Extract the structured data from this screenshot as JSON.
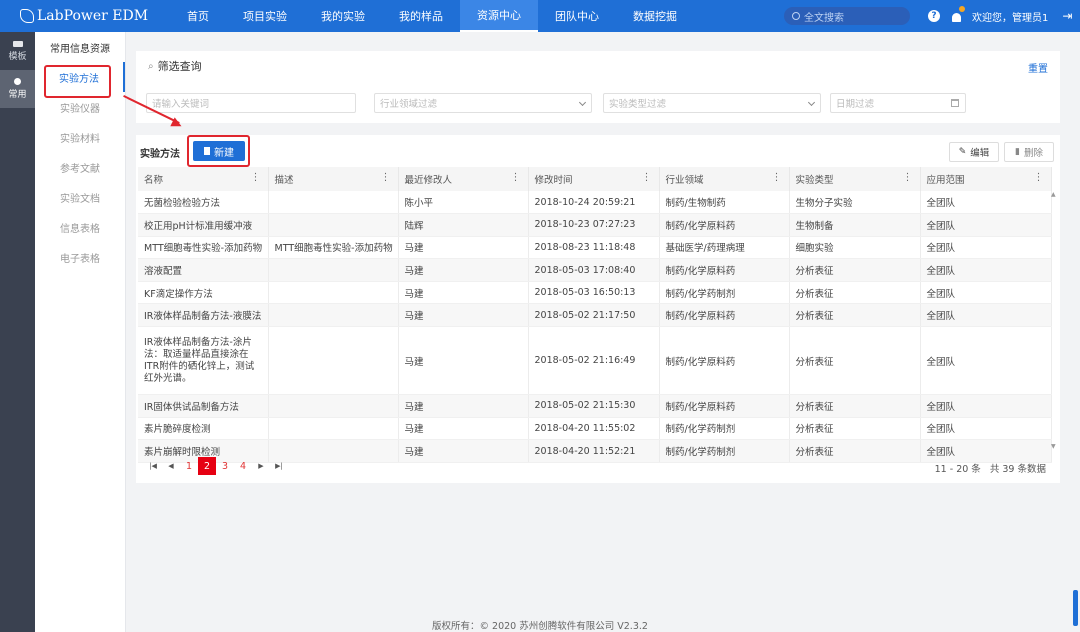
{
  "app": {
    "logo_text": "LabPower EDM"
  },
  "nav": [
    {
      "label": "首页"
    },
    {
      "label": "项目实验"
    },
    {
      "label": "我的实验"
    },
    {
      "label": "我的样品"
    },
    {
      "label": "资源中心",
      "active": true
    },
    {
      "label": "团队中心"
    },
    {
      "label": "数据挖掘"
    }
  ],
  "search": {
    "placeholder": "全文搜索"
  },
  "user": {
    "greeting": "欢迎您，管理员1"
  },
  "iconbar": [
    {
      "label": "模板"
    },
    {
      "label": "常用",
      "active": true
    }
  ],
  "submenu": {
    "title": "常用信息资源",
    "items": [
      {
        "label": "实验方法",
        "active": true
      },
      {
        "label": "实验仪器"
      },
      {
        "label": "实验材料"
      },
      {
        "label": "参考文献"
      },
      {
        "label": "实验文档"
      },
      {
        "label": "信息表格"
      },
      {
        "label": "电子表格"
      }
    ]
  },
  "filter": {
    "title": "筛选查询",
    "reset": "重置",
    "keyword_placeholder": "请输入关键词",
    "industry_placeholder": "行业领域过滤",
    "type_placeholder": "实验类型过滤",
    "date_placeholder": "日期过滤"
  },
  "panel": {
    "title": "实验方法",
    "new_label": "新建",
    "edit_label": "编辑",
    "delete_label": "删除"
  },
  "table": {
    "columns": [
      "名称",
      "描述",
      "最近修改人",
      "修改时间",
      "行业领域",
      "实验类型",
      "应用范围"
    ],
    "rows": [
      [
        "无菌检验检验方法",
        "",
        "陈小平",
        "2018-10-24 20:59:21",
        "制药/生物制药",
        "生物分子实验",
        "全团队"
      ],
      [
        "校正用pH计标准用缓冲液",
        "",
        "陆辉",
        "2018-10-23 07:27:23",
        "制药/化学原料药",
        "生物制备",
        "全团队"
      ],
      [
        "MTT细胞毒性实验-添加药物",
        "MTT细胞毒性实验-添加药物",
        "马建",
        "2018-08-23 11:18:48",
        "基础医学/药理病理",
        "细胞实验",
        "全团队"
      ],
      [
        "溶液配置",
        "",
        "马建",
        "2018-05-03 17:08:40",
        "制药/化学原料药",
        "分析表征",
        "全团队"
      ],
      [
        "KF滴定操作方法",
        "",
        "马建",
        "2018-05-03 16:50:13",
        "制药/化学药制剂",
        "分析表征",
        "全团队"
      ],
      [
        "IR液体样品制备方法-液膜法",
        "",
        "马建",
        "2018-05-02 21:17:50",
        "制药/化学原料药",
        "分析表征",
        "全团队"
      ],
      [
        "IR液体样品制备方法-涂片法：取适量样品直接涂在ITR附件的硒化锌上，测试红外光谱。",
        "",
        "马建",
        "2018-05-02 21:16:49",
        "制药/化学原料药",
        "分析表征",
        "全团队"
      ],
      [
        "IR固体供试品制备方法",
        "",
        "马建",
        "2018-05-02 21:15:30",
        "制药/化学原料药",
        "分析表征",
        "全团队"
      ],
      [
        "素片脆碎度检测",
        "",
        "马建",
        "2018-04-20 11:55:02",
        "制药/化学药制剂",
        "分析表征",
        "全团队"
      ],
      [
        "素片崩解时限检测",
        "",
        "马建",
        "2018-04-20 11:52:21",
        "制药/化学药制剂",
        "分析表征",
        "全团队"
      ]
    ]
  },
  "pager": {
    "pages": [
      "1",
      "2",
      "3",
      "4"
    ],
    "current": "2",
    "info": "11 - 20 条   共 39 条数据"
  },
  "footer": {
    "text": "版权所有：© 2020 苏州创腾软件有限公司   V2.3.2"
  },
  "colors": {
    "primary": "#1f6fd6",
    "annotation": "#e0262e",
    "current_page": "#e60012"
  }
}
